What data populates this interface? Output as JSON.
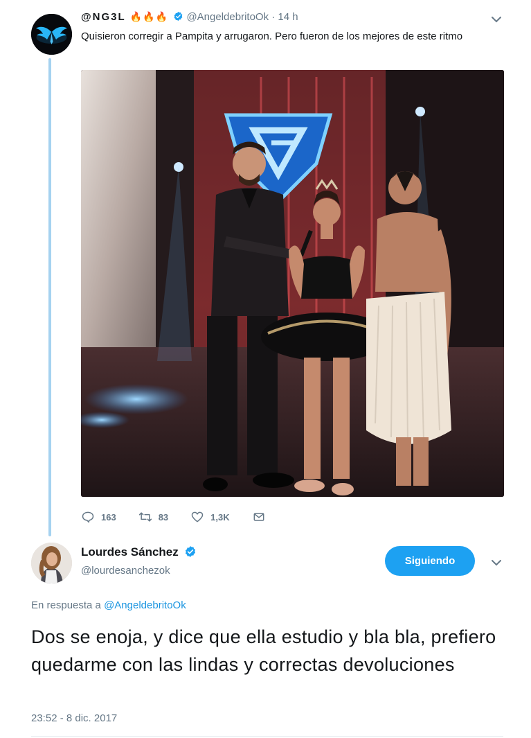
{
  "tweet1": {
    "name": "@NG3L",
    "flames": "🔥🔥🔥",
    "handle": "@AngeldebritoOk",
    "separator": "·",
    "time": "14 h",
    "text": "Quisieron corregir a Pampita y arrugaron. Pero fueron de los mejores de este ritmo",
    "avatar_icon": "blue-wings-logo",
    "verified_icon": "verified-badge",
    "actions": {
      "replies": "163",
      "retweets": "83",
      "likes": "1,3K"
    }
  },
  "tweet2": {
    "name": "Lourdes Sánchez",
    "handle": "@lourdesanchezok",
    "follow_label": "Siguiendo",
    "reply_prefix": "En respuesta a",
    "reply_mention": "@AngeldebritoOk",
    "text": "Dos se enoja, y dice que ella estudio y bla bla, prefiero quedarme con las lindas y correctas devoluciones",
    "timestamp": "23:52 - 8 dic. 2017"
  },
  "colors": {
    "accent": "#1da1f2",
    "mention": "#1b95e0",
    "muted": "#657786",
    "thread": "#a5d2f0"
  }
}
